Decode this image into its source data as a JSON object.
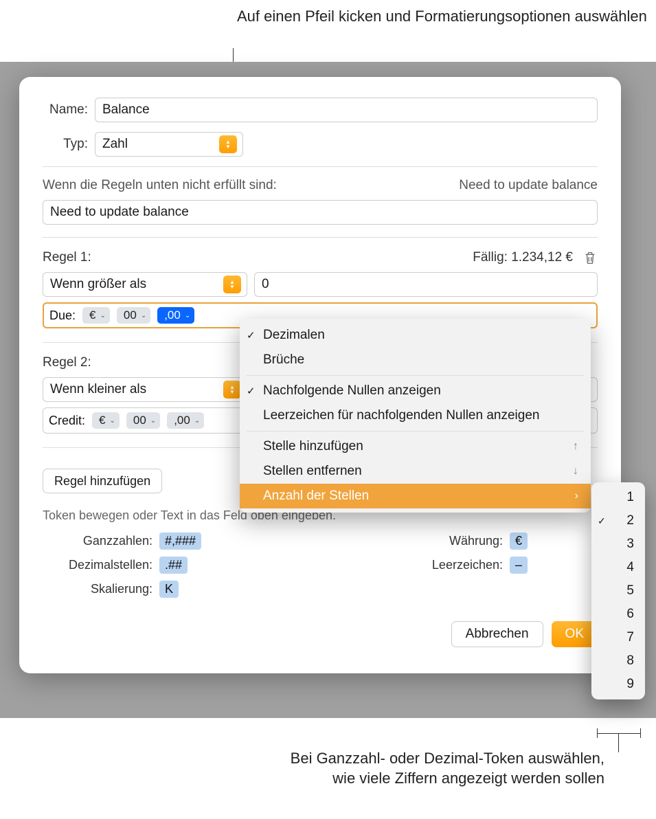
{
  "callouts": {
    "top": "Auf einen Pfeil kicken und Formatierungsoptionen auswählen",
    "bottom": "Bei Ganzzahl- oder Dezimal-Token auswählen, wie viele Ziffern angezeigt werden sollen"
  },
  "form": {
    "name_label": "Name:",
    "name_value": "Balance",
    "type_label": "Typ:",
    "type_value": "Zahl",
    "rules_not_met_label": "Wenn die Regeln unten nicht erfüllt sind:",
    "rules_not_met_preview": "Need to update balance",
    "rules_not_met_value": "Need to update balance"
  },
  "rule1": {
    "title": "Regel 1:",
    "example": "Fällig: 1.234,12 €",
    "condition": "Wenn größer als",
    "value": "0",
    "tokens": {
      "label": "Due:",
      "currency": "€",
      "integer": "00",
      "decimal": ",00"
    }
  },
  "rule2": {
    "title": "Regel 2:",
    "condition": "Wenn kleiner als",
    "tokens": {
      "label": "Credit:",
      "currency": "€",
      "integer": "00",
      "decimal": ",00"
    }
  },
  "add_rule": "Regel hinzufügen",
  "helper": "Token bewegen oder Text in das Feld oben eingeben.",
  "legend": {
    "ganzzahlen_label": "Ganzzahlen:",
    "ganzzahlen_value": "#,###",
    "dezimal_label": "Dezimalstellen:",
    "dezimal_value": ".##",
    "skalierung_label": "Skalierung:",
    "skalierung_value": "K",
    "waehrung_label": "Währung:",
    "waehrung_value": "€",
    "leerzeichen_label": "Leerzeichen:",
    "leerzeichen_value": "–"
  },
  "buttons": {
    "cancel": "Abbrechen",
    "ok": "OK"
  },
  "menu": {
    "dezimalen": "Dezimalen",
    "brueche": "Brüche",
    "trailing_zeros": "Nachfolgende Nullen anzeigen",
    "trailing_spaces": "Leerzeichen für nachfolgenden Nullen anzeigen",
    "add_digit": "Stelle hinzufügen",
    "remove_digit": "Stellen entfernen",
    "num_digits": "Anzahl der Stellen",
    "up_icon": "↑",
    "down_icon": "↓",
    "right_icon": "›"
  },
  "submenu_items": [
    "1",
    "2",
    "3",
    "4",
    "5",
    "6",
    "7",
    "8",
    "9"
  ],
  "submenu_checked_index": 1,
  "icons": {
    "check": "✓",
    "chevron": "⌄"
  }
}
